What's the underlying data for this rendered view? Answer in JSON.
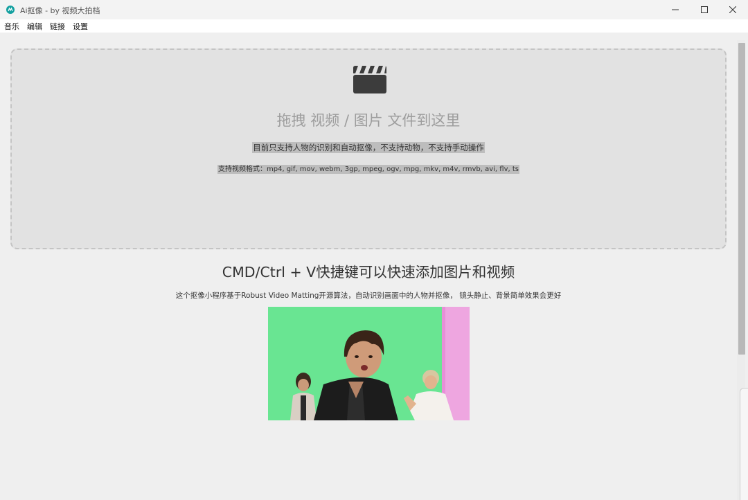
{
  "window": {
    "title": "Ai抠像 - by 视频大拍档",
    "icon": "app-logo-icon",
    "controls": [
      "minimize-icon",
      "maximize-icon",
      "close-icon"
    ]
  },
  "menu": {
    "items": [
      {
        "label": "音乐"
      },
      {
        "label": "编辑"
      },
      {
        "label": "链接"
      },
      {
        "label": "设置"
      }
    ]
  },
  "dropzone": {
    "icon": "clapperboard-icon",
    "title": "拖拽 视频 / 图片 文件到这里",
    "note": "目前只支持人物的识别和自动抠像，不支持动物，不支持手动操作",
    "formats": "支持视频格式：mp4, gif, mov, webm, 3gp, mpeg, ogv, mpg, mkv, m4v, rmvb, avi, flv, ts"
  },
  "main": {
    "shortcut_title": "CMD/Ctrl + V快捷键可以快速添加图片和视频",
    "description": "这个抠像小程序基于Robust Video Matting开源算法，自动识别画面中的人物并抠像， 镜头静止、背景简单效果会更好"
  },
  "colors": {
    "accent": "#13a0a0",
    "dropzone_bg": "#e2e2e2",
    "green_screen": "#69e592",
    "pink_panel": "#e88fd8"
  }
}
